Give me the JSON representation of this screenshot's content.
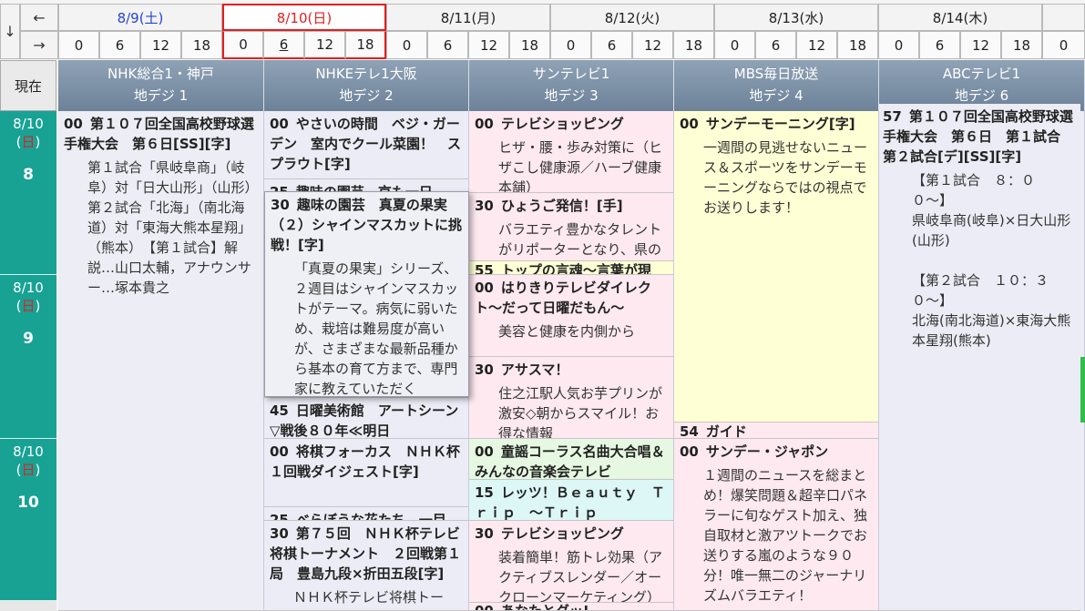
{
  "nav": {
    "prev_arrow": "←",
    "next_arrow": "→",
    "down_arrow": "↓"
  },
  "days": [
    {
      "label": "8/9(土)",
      "color": "#2444d8"
    },
    {
      "label": "8/10(日)",
      "color": "#e02020"
    },
    {
      "label": "8/11(月)",
      "color": "#222222"
    },
    {
      "label": "8/12(火)",
      "color": "#222222"
    },
    {
      "label": "8/13(水)",
      "color": "#222222"
    },
    {
      "label": "8/14(木)",
      "color": "#222222"
    }
  ],
  "hours": [
    "0",
    "6",
    "12",
    "18",
    "0",
    "6",
    "12",
    "18",
    "0",
    "6",
    "12",
    "18",
    "0",
    "6",
    "12",
    "18",
    "0",
    "6",
    "12",
    "18",
    "0",
    "6",
    "12",
    "18",
    "0"
  ],
  "now_label": "現在",
  "channels": [
    {
      "name": "NHK総合1・神戸",
      "sub": "地デジ 1"
    },
    {
      "name": "NHKEテレ1大阪",
      "sub": "地デジ 2"
    },
    {
      "name": "サンテレビ1",
      "sub": "地デジ 3"
    },
    {
      "name": "MBS毎日放送",
      "sub": "地デジ 4"
    },
    {
      "name": "ABCテレビ1",
      "sub": "地デジ 6"
    }
  ],
  "time_blocks": [
    {
      "date": "8/10",
      "weekday_open": "(",
      "weekday": "日",
      "weekday_close": ")",
      "hour": "8"
    },
    {
      "date": "8/10",
      "weekday_open": "(",
      "weekday": "日",
      "weekday_close": ")",
      "hour": "9"
    },
    {
      "date": "8/10",
      "weekday_open": "(",
      "weekday": "日",
      "weekday_close": ")",
      "hour": "10"
    }
  ],
  "programs": {
    "nhk1": [
      {
        "min": "00",
        "title": "第１０７回全国高校野球選手権大会　第６日[SS][字]",
        "desc": "第１試合「県岐阜商」（岐阜）対「日大山形」（山形）　第２試合「北海」（南北海道）対「東海大熊本星翔」（熊本）　【第１試合】解説…山口太輔，アナウンサー…塚本貴之"
      }
    ],
    "etv": [
      {
        "min": "00",
        "title": "やさいの時間　ベジ・ガーデン　室内でクール菜園！　スプラウト[字]",
        "desc": ""
      },
      {
        "min": "25",
        "title": "趣味の園芸　京も一日",
        "desc": ""
      },
      {
        "min": "45",
        "title": "日曜美術館　アートシーン▽戦後８０年≪明日",
        "desc": ""
      },
      {
        "min": "00",
        "title": "将棋フォーカス　ＮＨＫ杯　１回戦ダイジェスト[字]",
        "desc": ""
      },
      {
        "min": "25",
        "title": "べらぼうな花たち　一目",
        "desc": ""
      },
      {
        "min": "30",
        "title": "第７５回　ＮＨＫ杯テレビ将棋トーナメント　２回戦第１局　豊島九段×折田五段[字]",
        "desc": "ＮＨＫ杯テレビ将棋トー"
      }
    ],
    "popup": {
      "min": "30",
      "title": "趣味の園芸　真夏の果実（２）シャインマスカットに挑戦！[字]",
      "desc": "「真夏の果実」シリーズ、２週目はシャインマスカットがテーマ。病気に弱いため、栽培は難易度が高いが、さまざまな最新品種から基本の育て方まで、専門家に教えていただく"
    },
    "sun": [
      {
        "min": "00",
        "title": "テレビショッピング",
        "desc": "ヒザ・腰・歩み対策に（ヒザこし健康源／ハーブ健康本舗）"
      },
      {
        "min": "30",
        "title": "ひょうご発信！[手]",
        "desc": "バラエティ豊かなタレントがリポーターとなり、県の取り"
      },
      {
        "min": "55",
        "title": "トップの言魂〜言葉が現",
        "desc": ""
      },
      {
        "min": "00",
        "title": "はりきりテレビダイレクト〜だって日曜だもん〜",
        "desc": "美容と健康を内側から"
      },
      {
        "min": "30",
        "title": "アサスマ！",
        "desc": "住之江駅人気お芋プリンが激安◇朝からスマイル！お得な情報"
      },
      {
        "min": "00",
        "title": "童謡コーラス名曲大合唱＆みんなの音楽会テレビ",
        "desc": ""
      },
      {
        "min": "15",
        "title": "レッツ！Ｂｅａｕｔｙ　Ｔｒｉｐ　〜Ｔｒｉｐ",
        "desc": ""
      },
      {
        "min": "30",
        "title": "テレビショッピング",
        "desc": "装着簡単！筋トレ効果（アクティブスレンダー／オークローンマーケティング）"
      },
      {
        "min": "00",
        "title": "あなたとグッ!",
        "desc": ""
      }
    ],
    "mbs": [
      {
        "min": "00",
        "title": "サンデーモーニング[字]",
        "desc": "一週間の見逃せないニュース＆スポーツをサンデーモーニングならではの視点でお送りします！"
      },
      {
        "min": "54",
        "title": "ガイド",
        "desc": ""
      },
      {
        "min": "00",
        "title": "サンデー・ジャポン",
        "desc": "１週間のニュースを総まとめ！爆笑問題＆超辛口パネラーに旬なゲスト加え、独自取材と激アツトークでお送りする嵐のような９０分！唯一無二のジャーナリズムバラエティ！"
      }
    ],
    "abc": [
      {
        "min": "57",
        "title": "第１０７回全国高校野球選手権大会　第６日　第１試合　第２試合[デ][SS][字]",
        "desc": "【第１試合　８：００〜】\n県岐阜商(岐阜)×日大山形(山形)\n\n【第２試合　１０：３０〜】\n北海(南北海道)×東海大熊本星翔(熊本)"
      }
    ]
  }
}
